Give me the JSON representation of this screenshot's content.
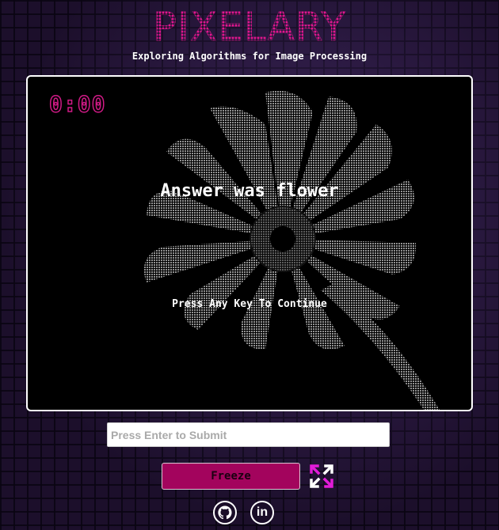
{
  "header": {
    "title": "PIXELARY",
    "subtitle": "Exploring Algorithms for Image Processing"
  },
  "game": {
    "timer": "0:00",
    "message": "Answer was flower",
    "prompt": "Press Any Key To Continue",
    "image_subject": "flower"
  },
  "controls": {
    "input_placeholder": "Press Enter to Submit",
    "input_value": "",
    "freeze_label": "Freeze",
    "expand_icon": "expand-arrows-icon"
  },
  "footer": {
    "links": [
      {
        "icon": "github-icon"
      },
      {
        "icon": "linkedin-icon",
        "label": "in"
      }
    ]
  },
  "colors": {
    "accent": "#e2168f",
    "button": "#a3045d",
    "background": "#1c0f2b"
  }
}
